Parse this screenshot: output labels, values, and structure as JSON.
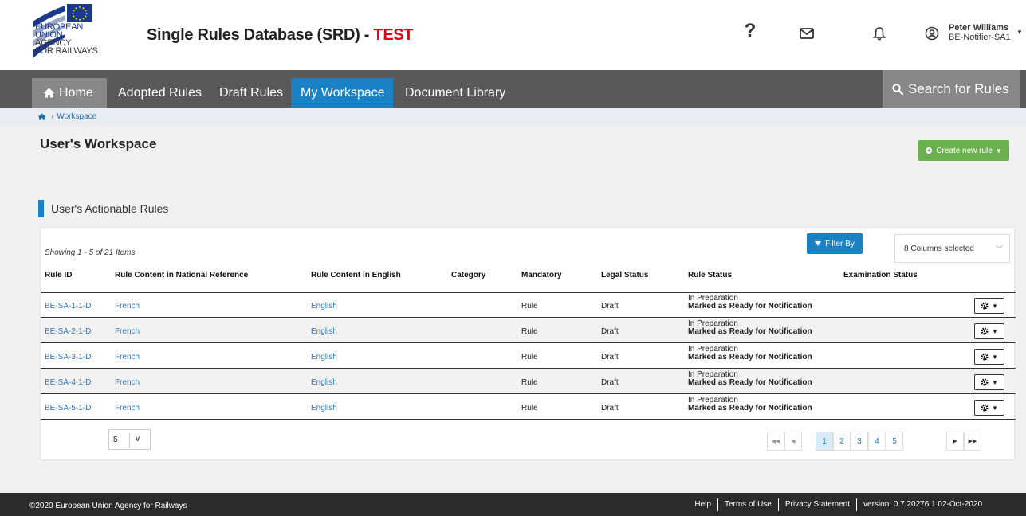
{
  "header": {
    "logo_lines": [
      "EUROPEAN",
      "UNION",
      "AGENCY",
      "FOR RAILWAYS"
    ],
    "title": "Single Rules Database (SRD) - ",
    "env": "TEST",
    "help_glyph": "?",
    "user": {
      "name": "Peter Williams",
      "role": "BE-Notifier-SA1"
    }
  },
  "nav": {
    "items": [
      {
        "label": "Home",
        "icon": "home-icon"
      },
      {
        "label": "Adopted Rules"
      },
      {
        "label": "Draft Rules"
      },
      {
        "label": "My Workspace"
      },
      {
        "label": "Document Library"
      }
    ],
    "search_label": "Search for Rules"
  },
  "breadcrumb": {
    "current": "Workspace"
  },
  "page": {
    "title": "User's Workspace",
    "create_label": "Create new rule",
    "section_title": "User's Actionable Rules"
  },
  "table": {
    "showing": "Showing 1 - 5 of 21 Items",
    "filter_label": "Filter By",
    "columns_selected": "8 Columns selected",
    "columns": [
      "Rule ID",
      "Rule Content in National Reference",
      "Rule Content in English",
      "Category",
      "Mandatory",
      "Legal Status",
      "Rule Status",
      "Examination Status"
    ],
    "rows": [
      {
        "id": "BE-SA-1-1-D",
        "national": "French",
        "english": "English",
        "category": "",
        "mandatory": "Rule",
        "legal": "Draft",
        "status": "In Preparation",
        "status_sub": "Marked as Ready for Notification",
        "exam": ""
      },
      {
        "id": "BE-SA-2-1-D",
        "national": "French",
        "english": "English",
        "category": "",
        "mandatory": "Rule",
        "legal": "Draft",
        "status": "In Preparation",
        "status_sub": "Marked as Ready for Notification",
        "exam": ""
      },
      {
        "id": "BE-SA-3-1-D",
        "national": "French",
        "english": "English",
        "category": "",
        "mandatory": "Rule",
        "legal": "Draft",
        "status": "In Preparation",
        "status_sub": "Marked as Ready for Notification",
        "exam": ""
      },
      {
        "id": "BE-SA-4-1-D",
        "national": "French",
        "english": "English",
        "category": "",
        "mandatory": "Rule",
        "legal": "Draft",
        "status": "In Preparation",
        "status_sub": "Marked as Ready for Notification",
        "exam": ""
      },
      {
        "id": "BE-SA-5-1-D",
        "national": "French",
        "english": "English",
        "category": "",
        "mandatory": "Rule",
        "legal": "Draft",
        "status": "In Preparation",
        "status_sub": "Marked as Ready for Notification",
        "exam": ""
      }
    ],
    "page_size": "5",
    "pages": [
      "1",
      "2",
      "3",
      "4",
      "5"
    ],
    "current_page": "1"
  },
  "footer": {
    "copyright": "©2020 European Union Agency for Railways",
    "links": [
      "Help",
      "Terms of Use",
      "Privacy Statement"
    ],
    "version": "version: 0.7.20276.1 02-Oct-2020"
  },
  "colors": {
    "nav_bg": "#595959",
    "active_tab": "#1a82c4",
    "create_button": "#6ab04c",
    "env_text": "#e3001b",
    "link": "#2f76b8"
  }
}
